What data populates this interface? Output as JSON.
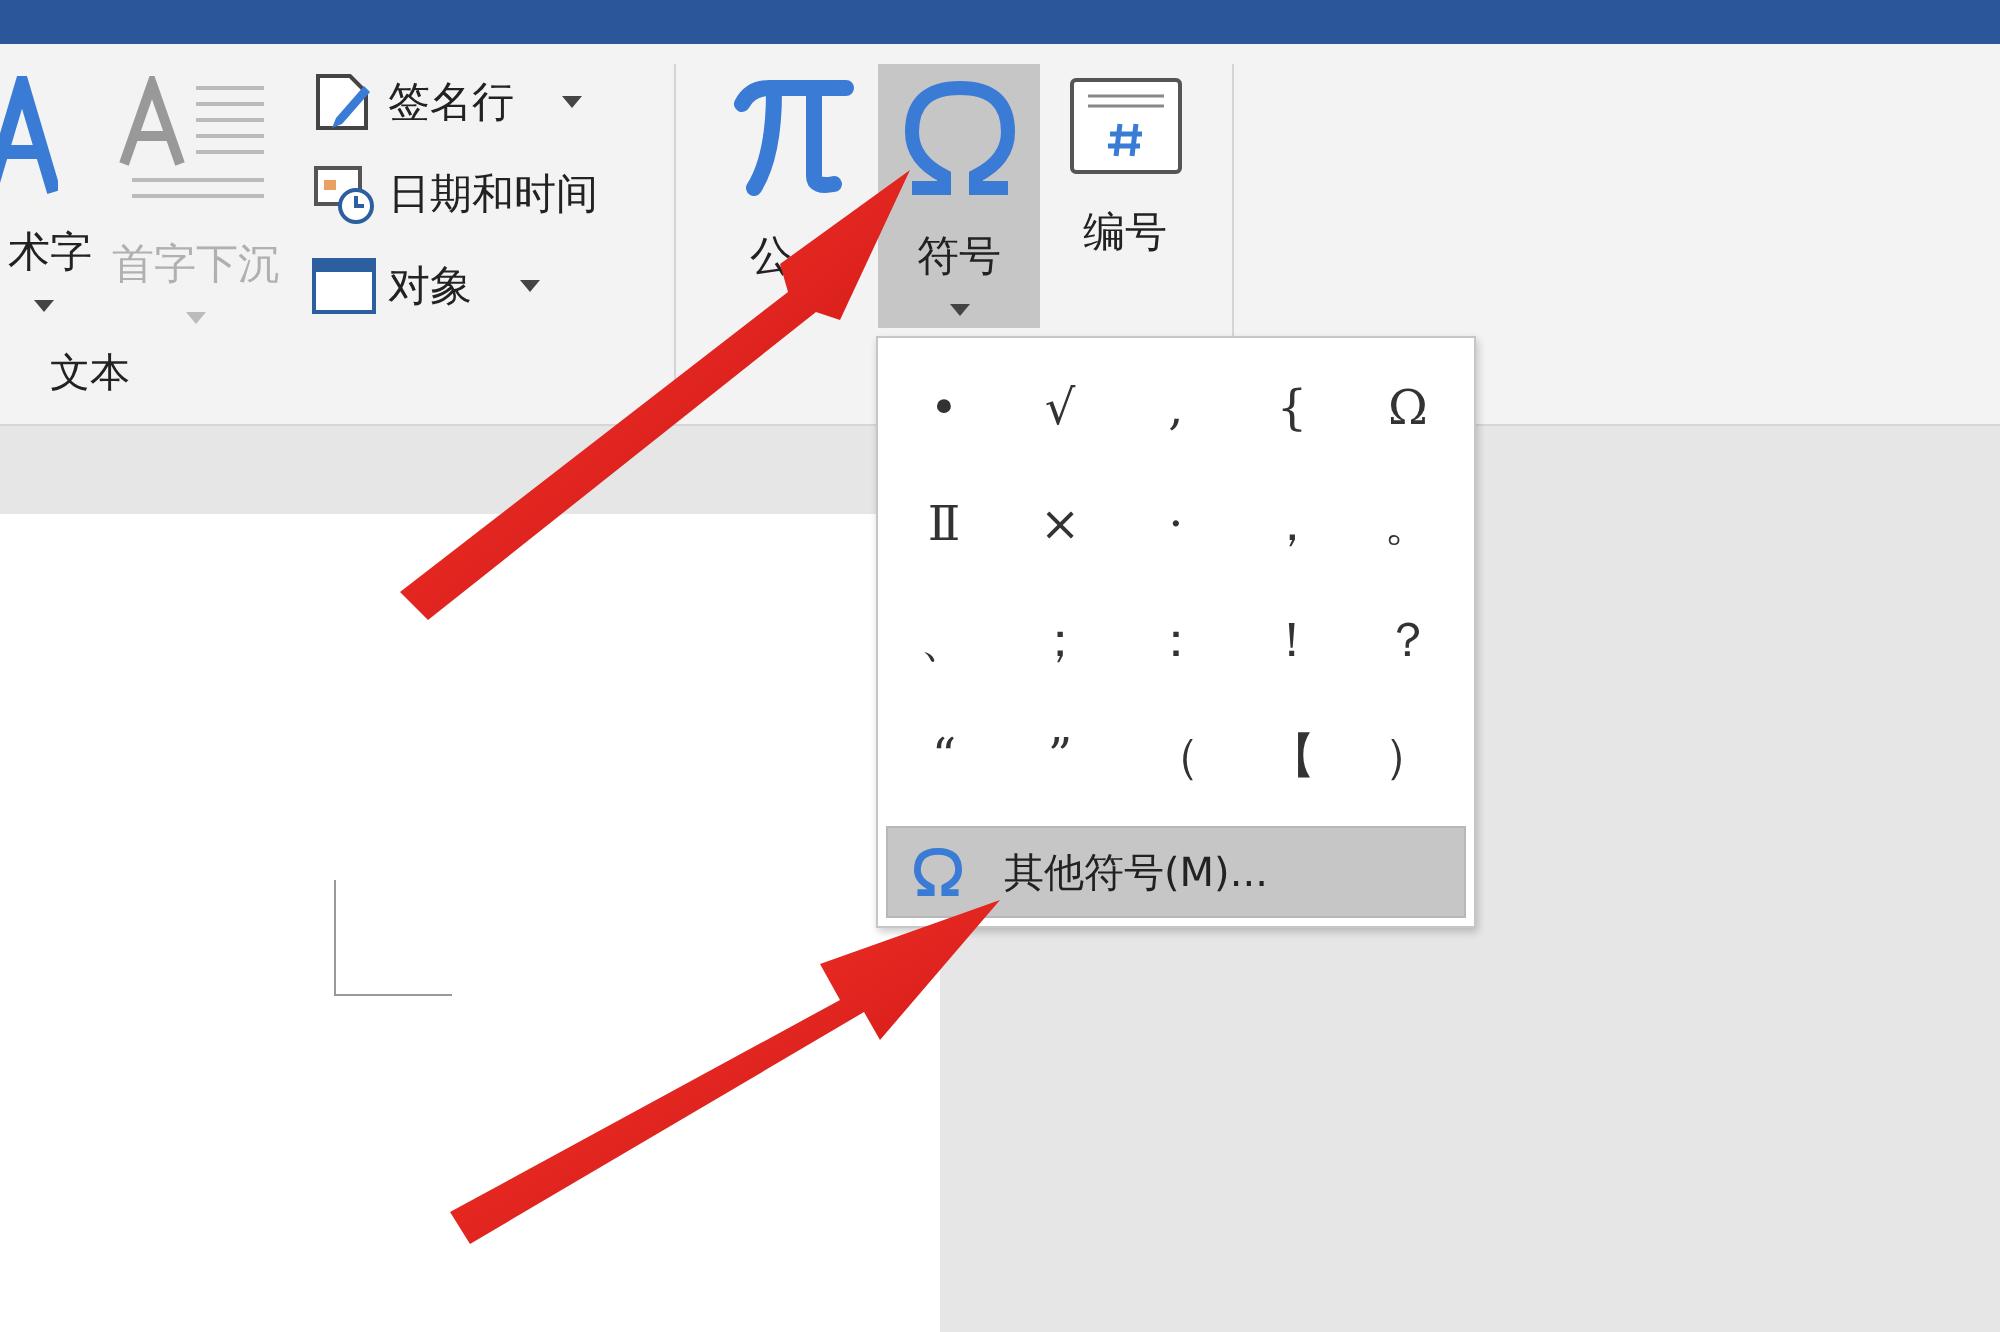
{
  "ribbon": {
    "text_group": {
      "label": "文本",
      "large_buttons": [
        {
          "kind": "wordart",
          "label": "术字",
          "disabled": false
        },
        {
          "kind": "dropcap",
          "label": "首字下沉",
          "disabled": true
        }
      ],
      "small_buttons": [
        {
          "kind": "signature",
          "label": "签名行",
          "has_dropdown": true
        },
        {
          "kind": "datetime",
          "label": "日期和时间",
          "has_dropdown": false
        },
        {
          "kind": "object",
          "label": "对象",
          "has_dropdown": true
        }
      ]
    },
    "symbol_group": {
      "buttons": [
        {
          "kind": "equation",
          "label": "公",
          "selected": false,
          "has_dropdown": false
        },
        {
          "kind": "symbol",
          "label": "符号",
          "selected": true,
          "has_dropdown": true
        },
        {
          "kind": "number",
          "label": "编号",
          "selected": false,
          "has_dropdown": false
        }
      ]
    }
  },
  "symbol_menu": {
    "symbols": [
      "•",
      "√",
      ",",
      "{",
      "Ω",
      "Ⅱ",
      "×",
      "·",
      "，",
      "。",
      "、",
      "；",
      "：",
      "！",
      "？",
      "“",
      "”",
      "（",
      "【",
      "）"
    ],
    "more_item": {
      "label": "其他符号(M)...",
      "highlighted": true
    }
  }
}
